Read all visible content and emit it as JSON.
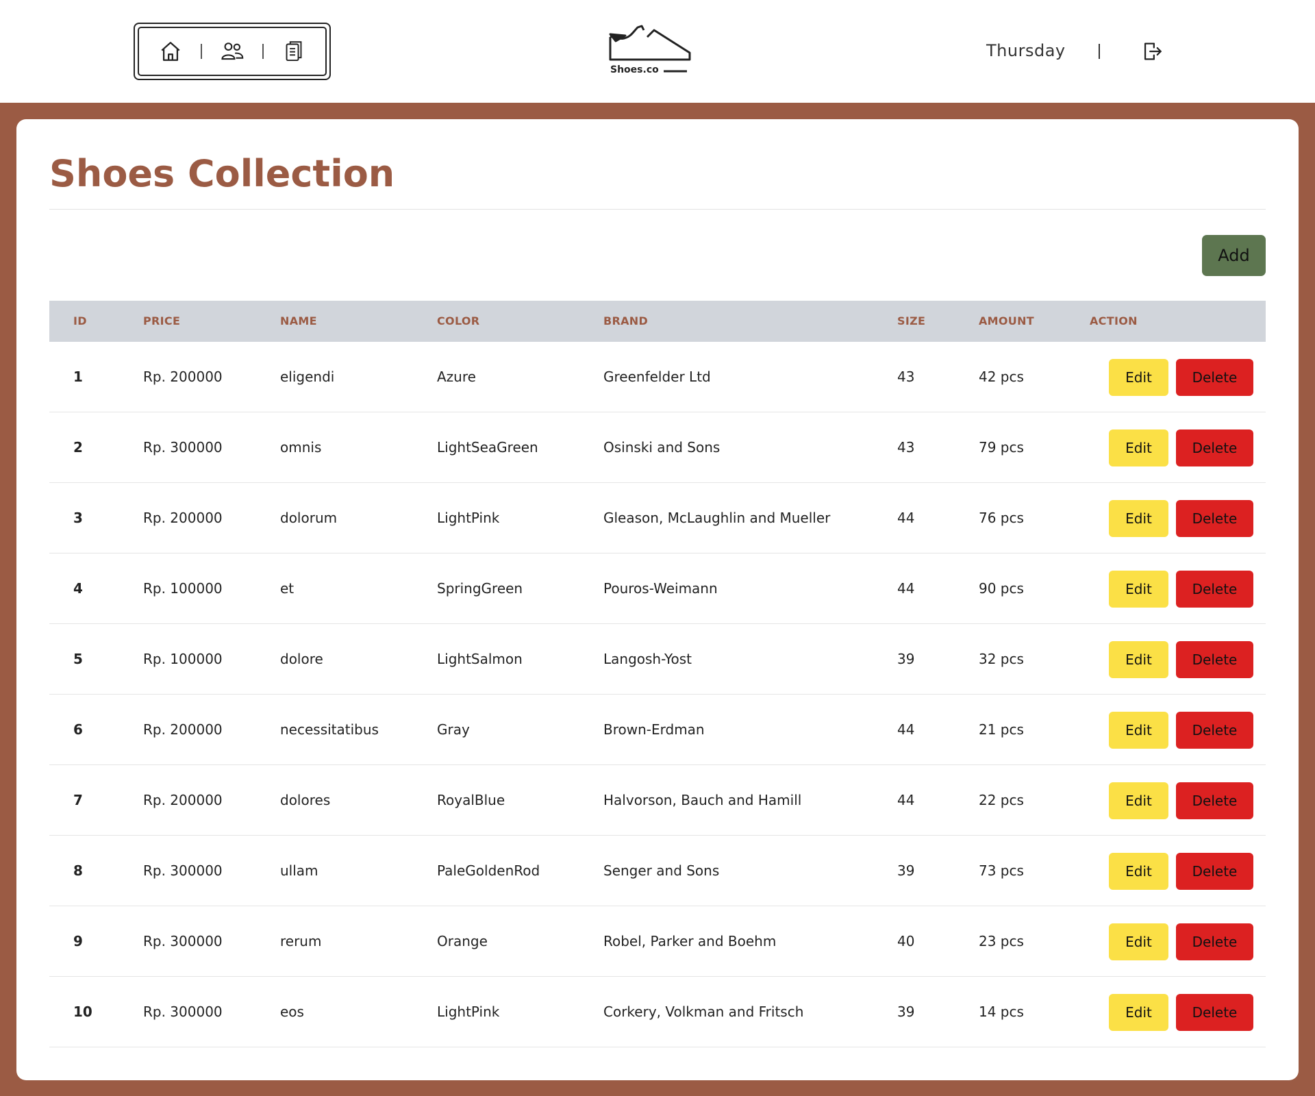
{
  "header": {
    "nav": [
      {
        "name": "home",
        "icon": "home-icon"
      },
      {
        "name": "users",
        "icon": "users-icon"
      },
      {
        "name": "clipboard",
        "icon": "clipboard-icon"
      }
    ],
    "logo_text": "Shoes.co",
    "day": "Thursday",
    "separator": "|"
  },
  "main": {
    "title": "Shoes Collection",
    "add_label": "Add"
  },
  "table": {
    "columns": [
      "ID",
      "PRICE",
      "NAME",
      "COLOR",
      "BRAND",
      "SIZE",
      "AMOUNT",
      "ACTION"
    ],
    "edit_label": "Edit",
    "delete_label": "Delete",
    "rows": [
      {
        "id": "1",
        "price": "Rp. 200000",
        "name": "eligendi",
        "color": "Azure",
        "brand": "Greenfelder Ltd",
        "size": "43",
        "amount": "42 pcs"
      },
      {
        "id": "2",
        "price": "Rp. 300000",
        "name": "omnis",
        "color": "LightSeaGreen",
        "brand": "Osinski and Sons",
        "size": "43",
        "amount": "79 pcs"
      },
      {
        "id": "3",
        "price": "Rp. 200000",
        "name": "dolorum",
        "color": "LightPink",
        "brand": "Gleason, McLaughlin and Mueller",
        "size": "44",
        "amount": "76 pcs"
      },
      {
        "id": "4",
        "price": "Rp. 100000",
        "name": "et",
        "color": "SpringGreen",
        "brand": "Pouros-Weimann",
        "size": "44",
        "amount": "90 pcs"
      },
      {
        "id": "5",
        "price": "Rp. 100000",
        "name": "dolore",
        "color": "LightSalmon",
        "brand": "Langosh-Yost",
        "size": "39",
        "amount": "32 pcs"
      },
      {
        "id": "6",
        "price": "Rp. 200000",
        "name": "necessitatibus",
        "color": "Gray",
        "brand": "Brown-Erdman",
        "size": "44",
        "amount": "21 pcs"
      },
      {
        "id": "7",
        "price": "Rp. 200000",
        "name": "dolores",
        "color": "RoyalBlue",
        "brand": "Halvorson, Bauch and Hamill",
        "size": "44",
        "amount": "22 pcs"
      },
      {
        "id": "8",
        "price": "Rp. 300000",
        "name": "ullam",
        "color": "PaleGoldenRod",
        "brand": "Senger and Sons",
        "size": "39",
        "amount": "73 pcs"
      },
      {
        "id": "9",
        "price": "Rp. 300000",
        "name": "rerum",
        "color": "Orange",
        "brand": "Robel, Parker and Boehm",
        "size": "40",
        "amount": "23 pcs"
      },
      {
        "id": "10",
        "price": "Rp. 300000",
        "name": "eos",
        "color": "LightPink",
        "brand": "Corkery, Volkman and Fritsch",
        "size": "39",
        "amount": "14 pcs"
      }
    ]
  },
  "colors": {
    "brand": "#9b5b44",
    "add_button": "#5d7650",
    "edit_button": "#fbe046",
    "delete_button": "#dc2121",
    "table_header": "#d1d5db"
  }
}
